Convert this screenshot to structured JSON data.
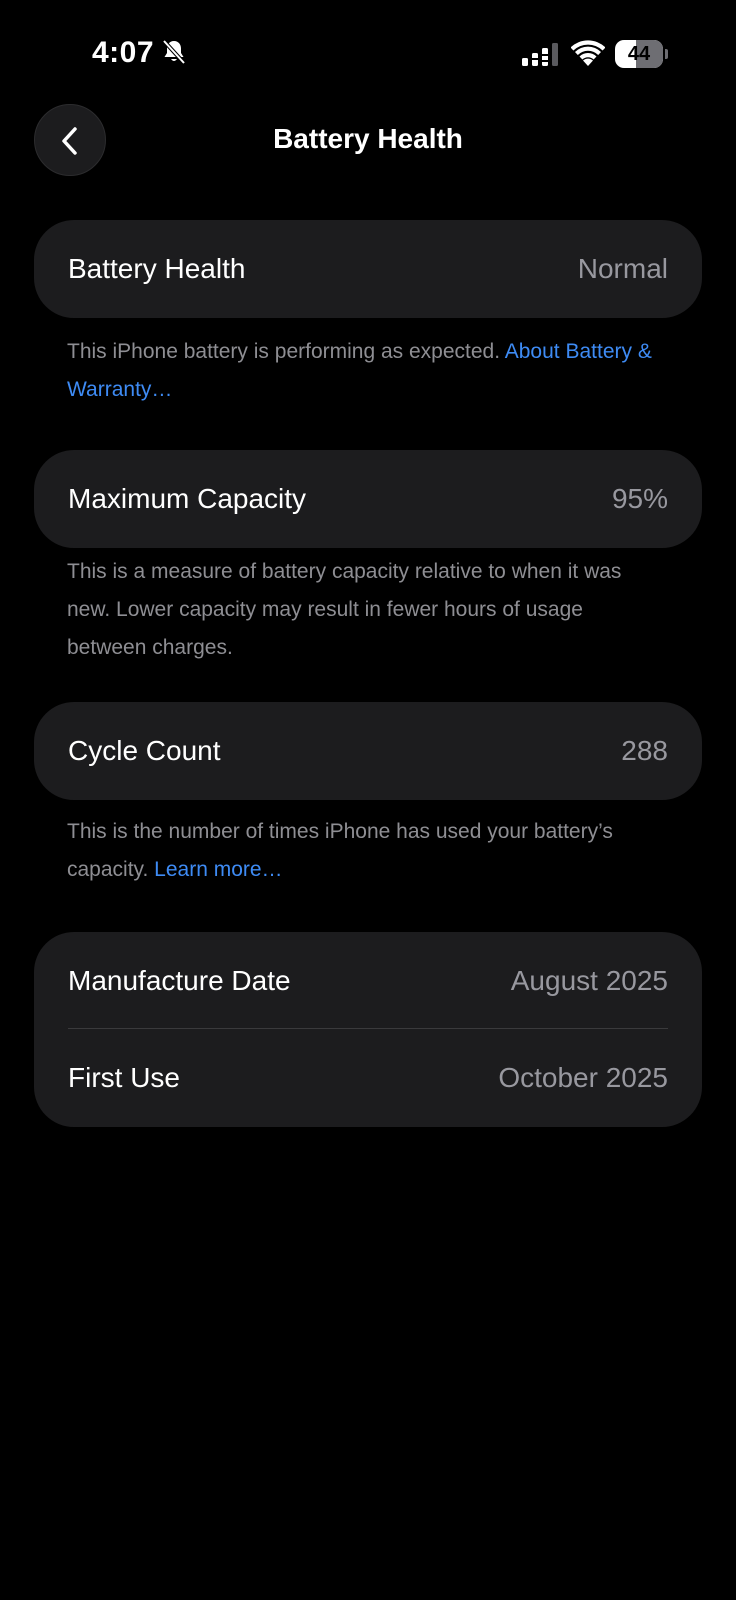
{
  "status_bar": {
    "time": "4:07",
    "battery_level": "44",
    "battery_fraction": 0.44
  },
  "nav": {
    "title": "Battery Health"
  },
  "battery_health": {
    "label": "Battery Health",
    "value": "Normal",
    "footnote": "This iPhone battery is performing as expected.",
    "link": "About Battery & Warranty…"
  },
  "maximum_capacity": {
    "label": "Maximum Capacity",
    "value": "95%",
    "footnote": "This is a measure of battery capacity relative to when it was new. Lower capacity may result in fewer hours of usage between charges."
  },
  "cycle_count": {
    "label": "Cycle Count",
    "value": "288",
    "footnote": "This is the number of times iPhone has used your battery’s capacity.",
    "link": "Learn more…"
  },
  "dates": {
    "manufacture_label": "Manufacture Date",
    "manufacture_value": "August 2025",
    "first_use_label": "First Use",
    "first_use_value": "October 2025"
  },
  "icons": {
    "bell": "bell-slash-icon",
    "signal": "cellular-signal-icon",
    "wifi": "wifi-icon",
    "battery": "battery-icon",
    "back": "chevron-left-icon"
  },
  "colors": {
    "background": "#000000",
    "card": "#1c1c1e",
    "secondary_text": "#8e8e93",
    "value_text": "#98989f",
    "link": "#3e8bf4"
  }
}
